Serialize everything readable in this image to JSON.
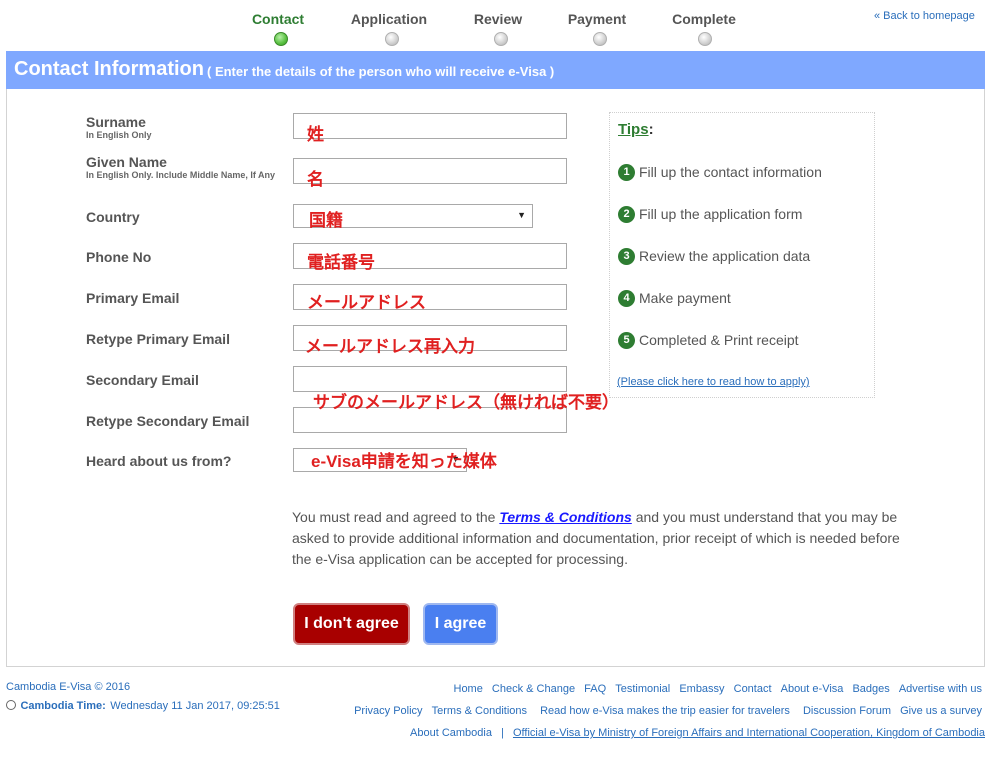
{
  "steps": [
    {
      "label": "Contact",
      "active": true
    },
    {
      "label": "Application",
      "active": false
    },
    {
      "label": "Review",
      "active": false
    },
    {
      "label": "Payment",
      "active": false
    },
    {
      "label": "Complete",
      "active": false
    }
  ],
  "back_link": "« Back to homepage",
  "banner": {
    "title": "Contact Information",
    "subtitle": "( Enter the details of the person who will receive e-Visa )"
  },
  "form": {
    "surname": {
      "label": "Surname",
      "sub": "In English Only",
      "value": "",
      "annotation": "姓"
    },
    "given_name": {
      "label": "Given Name",
      "sub": "In English Only. Include Middle Name, If Any",
      "value": "",
      "annotation": "名"
    },
    "country": {
      "label": "Country",
      "value": "",
      "annotation": "国籍"
    },
    "phone": {
      "label": "Phone No",
      "value": "",
      "annotation": "電話番号"
    },
    "primary_email": {
      "label": "Primary Email",
      "value": "",
      "annotation": "メールアドレス"
    },
    "retype_primary_email": {
      "label": "Retype Primary Email",
      "value": "",
      "annotation": "メールアドレス再入力"
    },
    "secondary_email": {
      "label": "Secondary Email",
      "value": "",
      "annotation": "サブのメールアドレス（無ければ不要）"
    },
    "retype_secondary_email": {
      "label": "Retype Secondary Email",
      "value": ""
    },
    "heard_about": {
      "label": "Heard about us from?",
      "value": "",
      "annotation": "e-Visa申請を知った媒体"
    }
  },
  "tips": {
    "title": "Tips",
    "colon": ":",
    "items": [
      {
        "num": "1",
        "text": "Fill up the contact information"
      },
      {
        "num": "2",
        "text": "Fill up the application form"
      },
      {
        "num": "3",
        "text": "Review the application data"
      },
      {
        "num": "4",
        "text": "Make payment"
      },
      {
        "num": "5",
        "text": "Completed & Print receipt"
      }
    ],
    "link": "(Please click here to read how to apply)"
  },
  "terms": {
    "before": "You must read and agreed to the ",
    "link": "Terms & Conditions",
    "after": " and you must understand that you may be asked to provide additional information and documentation, prior receipt of which is needed before the e-Visa application can be accepted for processing."
  },
  "buttons": {
    "disagree": "I don't agree",
    "agree": "I agree"
  },
  "footer": {
    "copyright": "Cambodia E-Visa © 2016",
    "time_label": "Cambodia Time:",
    "time_value": "Wednesday 11 Jan 2017, 09:25:51",
    "row1": [
      "Home",
      "Check & Change",
      "FAQ",
      "Testimonial",
      "Embassy",
      "Contact",
      "About e-Visa",
      "Badges",
      "Advertise with us"
    ],
    "row2": [
      "Privacy Policy",
      "Terms & Conditions",
      "Read how e-Visa makes the trip easier for travelers",
      "Discussion Forum",
      "Give us a survey"
    ],
    "row3": [
      "About Cambodia",
      "|",
      "Official e-Visa by Ministry of Foreign Affairs and International Cooperation, Kingdom of Cambodia"
    ]
  },
  "colors": {
    "banner": "#7fa8ff",
    "accent_green": "#2e7d32",
    "disagree": "#a80000",
    "agree": "#4a7ff0",
    "annotation": "#e02020"
  }
}
